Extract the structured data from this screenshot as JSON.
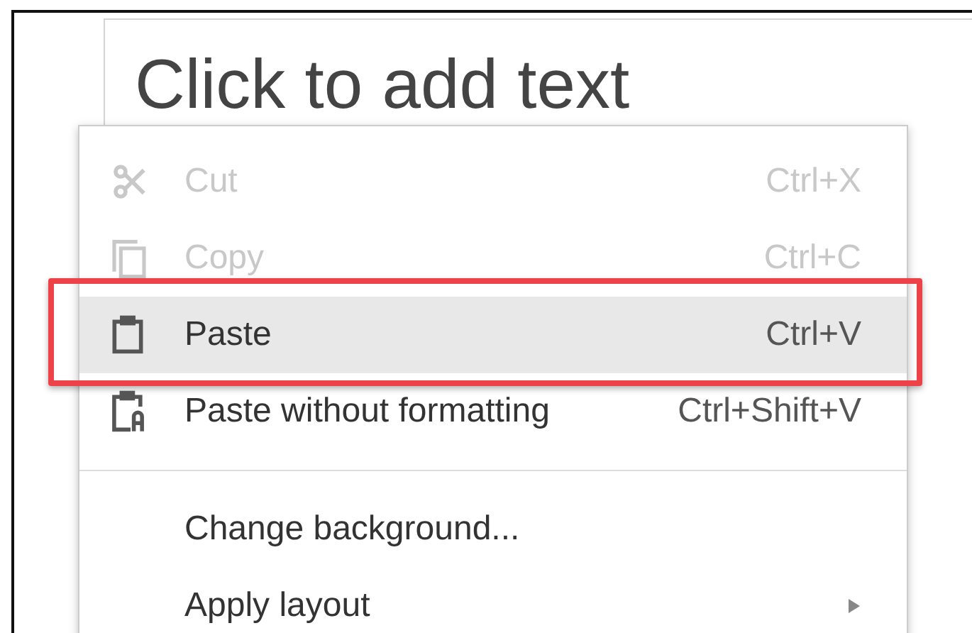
{
  "slide": {
    "placeholder": "Click to add text"
  },
  "menu": [
    {
      "kind": "item",
      "label": "Cut",
      "shortcut": "Ctrl+X",
      "disabled": true,
      "selected": false
    },
    {
      "kind": "item",
      "label": "Copy",
      "shortcut": "Ctrl+C",
      "disabled": true,
      "selected": false
    },
    {
      "kind": "item",
      "label": "Paste",
      "shortcut": "Ctrl+V",
      "disabled": false,
      "selected": true,
      "outlined": true
    },
    {
      "kind": "item",
      "label": "Paste without formatting",
      "shortcut": "Ctrl+Shift+V",
      "disabled": false,
      "selected": false
    },
    {
      "kind": "separator"
    },
    {
      "kind": "item",
      "label": "Change background...",
      "disabled": false,
      "selected": false
    },
    {
      "kind": "item",
      "label": "Apply layout",
      "disabled": false,
      "selected": false,
      "submenu": true
    }
  ]
}
